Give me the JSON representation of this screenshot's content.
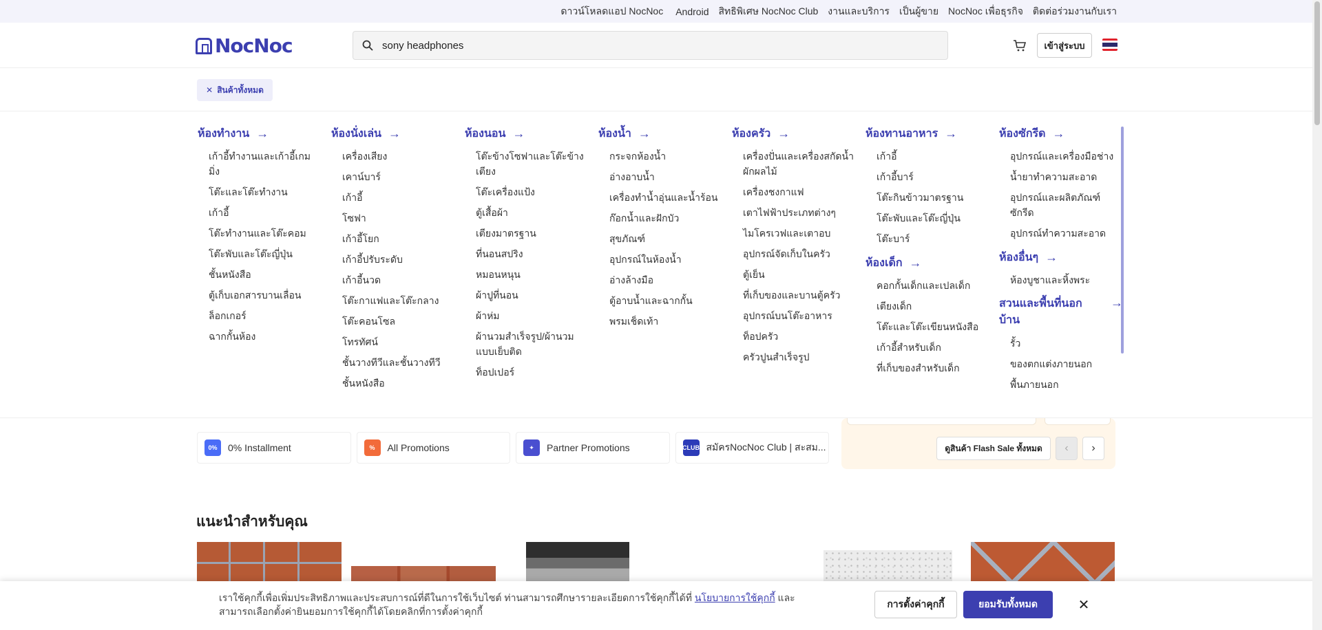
{
  "topstrip": {
    "download": "ดาวน์โหลดแอป NocNoc",
    "links": [
      "Android",
      "สิทธิพิเศษ NocNoc Club",
      "งานและบริการ",
      "เป็นผู้ขาย",
      "NocNoc เพื่อธุรกิจ",
      "ติดต่อร่วมงานกับเรา"
    ]
  },
  "header": {
    "logo": "NocNoc",
    "search_value": "sony headphones",
    "login": "เข้าสู่ระบบ"
  },
  "all_categories": "สินค้าทั้งหมด",
  "columns": [
    {
      "title": "ห้องทำงาน",
      "items": [
        "เก้าอี้ทำงานและเก้าอี้เกมมิ่ง",
        "โต๊ะและโต๊ะทำงาน",
        "เก้าอี้",
        "โต๊ะทำงานและโต๊ะคอม",
        "โต๊ะพับและโต๊ะญี่ปุ่น",
        "ชั้นหนังสือ",
        "ตู้เก็บเอกสารบานเลื่อน",
        "ล็อกเกอร์",
        "ฉากกั้นห้อง"
      ]
    },
    {
      "title": "ห้องนั่งเล่น",
      "items": [
        "เครื่องเสียง",
        "เคาน์บาร์",
        "เก้าอี้",
        "โซฟา",
        "เก้าอี้โยก",
        "เก้าอี้ปรับระดับ",
        "เก้าอี้นวด",
        "โต๊ะกาแฟและโต๊ะกลาง",
        "โต๊ะคอนโซล",
        "โทรทัศน์",
        "ชั้นวางทีวีและชั้นวางทีวี",
        "ชั้นหนังสือ"
      ]
    },
    {
      "title": "ห้องนอน",
      "items": [
        "โต๊ะข้างโซฟาและโต๊ะข้างเตียง",
        "โต๊ะเครื่องแป้ง",
        "ตู้เสื้อผ้า",
        "เตียงมาตรฐาน",
        "ที่นอนสปริง",
        "หมอนหนุน",
        "ผ้าปูที่นอน",
        "ผ้าห่ม",
        "ผ้านวมสำเร็จรูป/ผ้านวมแบบเย็บติด",
        "ท็อปเปอร์"
      ]
    },
    {
      "title": "ห้องน้ำ",
      "items": [
        "กระจกห้องน้ำ",
        "อ่างอาบน้ำ",
        "เครื่องทำน้ำอุ่นและน้ำร้อน",
        "ก๊อกน้ำและฝักบัว",
        "สุขภัณฑ์",
        "อุปกรณ์ในห้องน้ำ",
        "อ่างล้างมือ",
        "ตู้อาบน้ำและฉากกั้น",
        "พรมเช็ดเท้า"
      ]
    },
    {
      "title": "ห้องครัว",
      "items": [
        "เครื่องปั่นและเครื่องสกัดน้ำผักผลไม้",
        "เครื่องชงกาแฟ",
        "เตาไฟฟ้าประเภทต่างๆ",
        "ไมโครเวฟและเตาอบ",
        "อุปกรณ์จัดเก็บในครัว",
        "ตู้เย็น",
        "ที่เก็บของและบานตู้ครัว",
        "อุปกรณ์บนโต๊ะอาหาร",
        "ท็อปครัว",
        "ครัวปูนสำเร็จรูป"
      ]
    },
    {
      "title": "ห้องทานอาหาร",
      "items": [
        "เก้าอี้",
        "เก้าอี้บาร์",
        "โต๊ะกินข้าวมาตรฐาน",
        "โต๊ะพับและโต๊ะญี่ปุ่น",
        "โต๊ะบาร์"
      ],
      "sub": {
        "title": "ห้องเด็ก",
        "items": [
          "คอกกั้นเด็กและเปลเด็ก",
          "เตียงเด็ก",
          "โต๊ะและโต๊ะเขียนหนังสือ",
          "เก้าอี้สำหรับเด็ก",
          "ที่เก็บของสำหรับเด็ก"
        ]
      }
    },
    {
      "title": "ห้องซักรีด",
      "items": [
        "อุปกรณ์และเครื่องมือช่าง",
        "น้ำยาทำความสะอาด",
        "อุปกรณ์และผลิตภัณฑ์ซักรีด",
        "อุปกรณ์ทำความสะอาด"
      ],
      "sub": {
        "title": "ห้องอื่นๆ",
        "items": [
          "ห้องบูชาและหิ้งพระ"
        ]
      },
      "sub2": {
        "title": "สวนและพื้นที่นอกบ้าน",
        "items": [
          "รั้ว",
          "ของตกแต่งภายนอก",
          "พื้นภายนอก"
        ]
      }
    }
  ],
  "promos": [
    {
      "label": "0% Installment",
      "icon": "installment-icon",
      "color": "#4a6cf7"
    },
    {
      "label": "All Promotions",
      "icon": "promotion-tag-icon",
      "color": "#f26b3a"
    },
    {
      "label": "Partner Promotions",
      "icon": "handshake-icon",
      "color": "#4a4fd0"
    },
    {
      "label": "สมัครNocNoc Club | สะสม...",
      "icon": "nocnoc-club-icon",
      "color": "#2c3bb8"
    }
  ],
  "flash": {
    "see_all": "ดูสินค้า Flash Sale ทั้งหมด"
  },
  "recommended": {
    "title": "แนะนำสำหรับคุณ"
  },
  "cookie": {
    "text_before": "เราใช้คุกกี้เพื่อเพิ่มประสิทธิภาพและประสบการณ์ที่ดีในการใช้เว็บไซต์ ท่านสามารถศึกษารายละเอียดการใช้คุกกี้ได้ที่ ",
    "policy_link": "นโยบายการใช้คุกกี้",
    "text_after": " และสามารถเลือกตั้งค่ายินยอมการใช้คุกกี้ได้โดยคลิกที่การตั้งค่าคุกกี้",
    "settings": "การตั้งค่าคุกกี้",
    "accept": "ยอมรับทั้งหมด"
  },
  "colors": {
    "brand": "#3c3fb0",
    "flash_bg": "#fff6e9"
  }
}
